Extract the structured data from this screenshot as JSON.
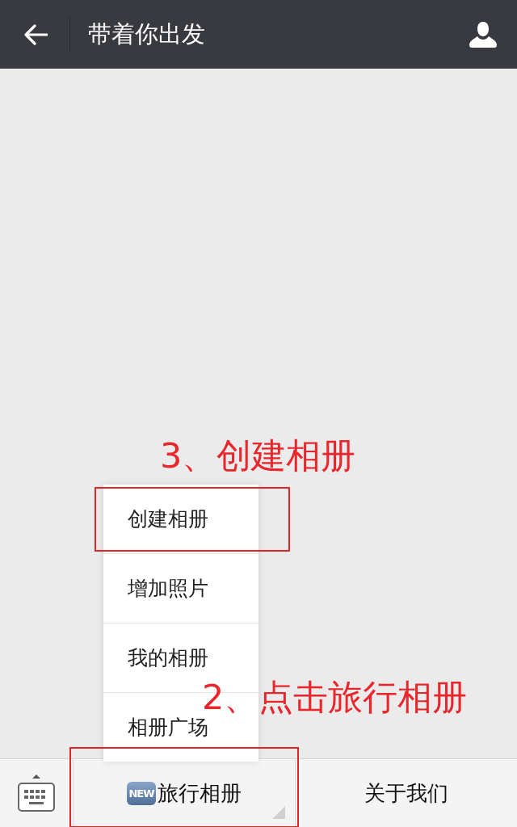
{
  "header": {
    "title": "带着你出发"
  },
  "menu": {
    "items": [
      {
        "label": "创建相册"
      },
      {
        "label": "增加照片"
      },
      {
        "label": "我的相册"
      },
      {
        "label": "相册广场"
      }
    ]
  },
  "bottom_bar": {
    "items": [
      {
        "label": "旅行相册",
        "badge": "NEW",
        "has_submenu": true
      },
      {
        "label": "关于我们",
        "has_submenu": false
      }
    ]
  },
  "annotations": [
    {
      "text": "3、创建相册",
      "kind": "menu"
    },
    {
      "text": "2、点击旅行相册",
      "kind": "bottom"
    }
  ]
}
